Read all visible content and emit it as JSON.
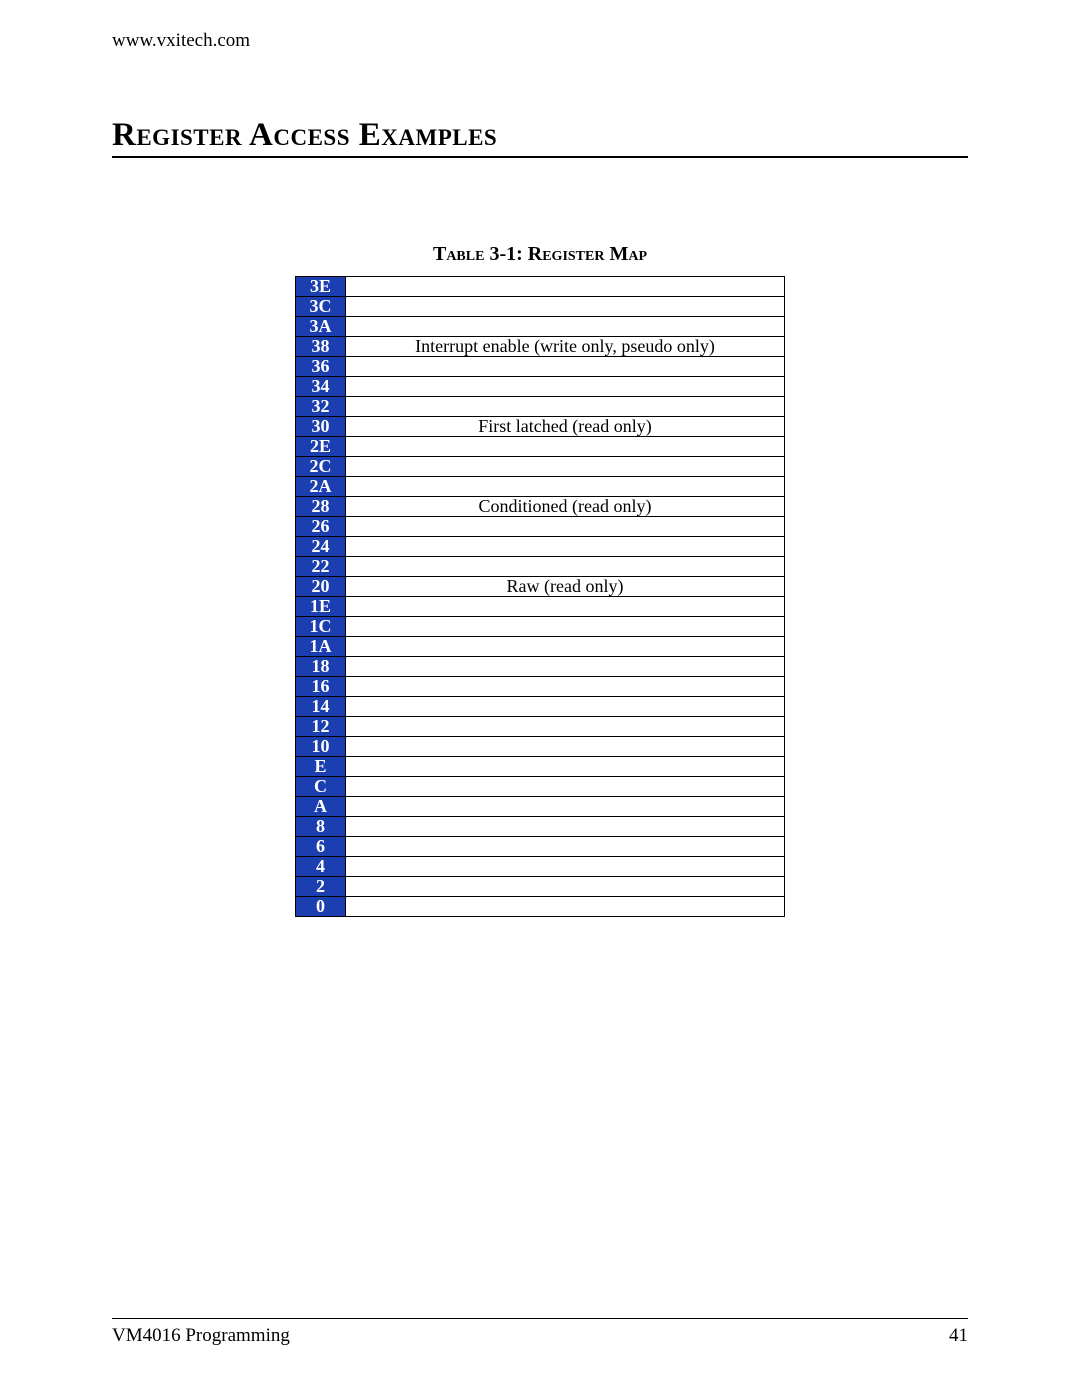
{
  "header": {
    "url": "www.vxitech.com"
  },
  "section": {
    "title": "Register Access Examples"
  },
  "table": {
    "caption": "Table 3-1: Register Map",
    "rows": [
      {
        "addr": "3E",
        "desc": ""
      },
      {
        "addr": "3C",
        "desc": ""
      },
      {
        "addr": "3A",
        "desc": ""
      },
      {
        "addr": "38",
        "desc": "Interrupt enable (write only, pseudo only)"
      },
      {
        "addr": "36",
        "desc": ""
      },
      {
        "addr": "34",
        "desc": ""
      },
      {
        "addr": "32",
        "desc": ""
      },
      {
        "addr": "30",
        "desc": "First latched (read only)"
      },
      {
        "addr": "2E",
        "desc": ""
      },
      {
        "addr": "2C",
        "desc": ""
      },
      {
        "addr": "2A",
        "desc": ""
      },
      {
        "addr": "28",
        "desc": "Conditioned (read only)"
      },
      {
        "addr": "26",
        "desc": ""
      },
      {
        "addr": "24",
        "desc": ""
      },
      {
        "addr": "22",
        "desc": ""
      },
      {
        "addr": "20",
        "desc": "Raw (read only)"
      },
      {
        "addr": "1E",
        "desc": ""
      },
      {
        "addr": "1C",
        "desc": ""
      },
      {
        "addr": "1A",
        "desc": ""
      },
      {
        "addr": "18",
        "desc": ""
      },
      {
        "addr": "16",
        "desc": ""
      },
      {
        "addr": "14",
        "desc": ""
      },
      {
        "addr": "12",
        "desc": ""
      },
      {
        "addr": "10",
        "desc": ""
      },
      {
        "addr": "E",
        "desc": ""
      },
      {
        "addr": "C",
        "desc": ""
      },
      {
        "addr": "A",
        "desc": ""
      },
      {
        "addr": "8",
        "desc": ""
      },
      {
        "addr": "6",
        "desc": ""
      },
      {
        "addr": "4",
        "desc": ""
      },
      {
        "addr": "2",
        "desc": ""
      },
      {
        "addr": "0",
        "desc": ""
      }
    ]
  },
  "footer": {
    "left": "VM4016 Programming",
    "right": "41"
  },
  "colors": {
    "brand_blue": "#1b3fb0"
  }
}
